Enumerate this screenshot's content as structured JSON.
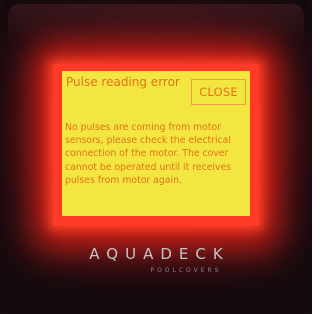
{
  "dialog": {
    "title": "Pulse reading error",
    "close_label": "CLOSE",
    "message": "No pulses are coming from motor sensors, please check the electrical connection of the motor. The cover cannot be operated until it receives pulses from motor again."
  },
  "brand": {
    "name": "AQUADECK",
    "tagline": "POOLCOVERS"
  },
  "colors": {
    "dialog_background": "#f3e640",
    "dialog_text": "#e0731c",
    "screen_backlight": "#ff3a26",
    "device_body": "#1d0b10"
  }
}
